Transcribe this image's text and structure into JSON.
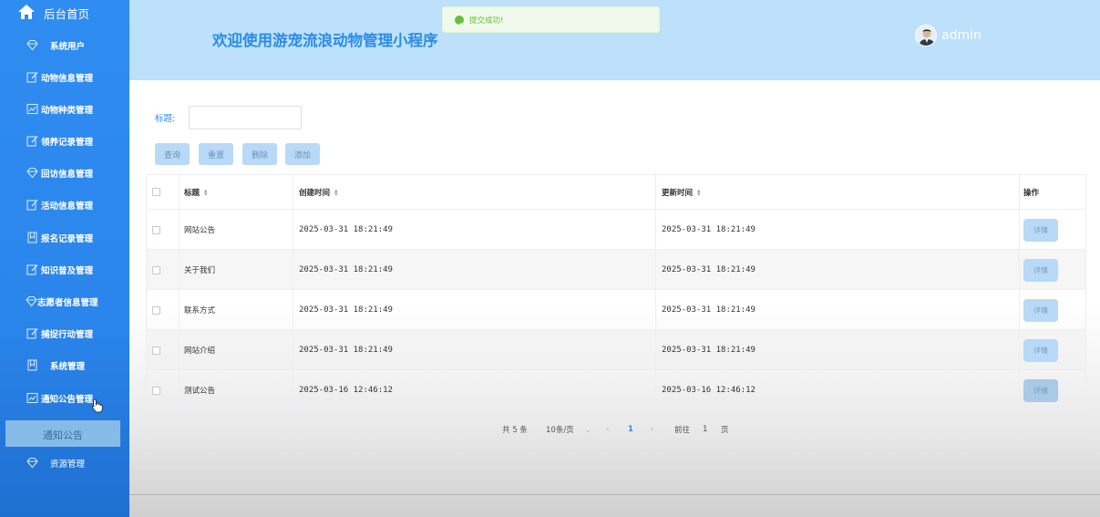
{
  "sidebar": {
    "home_label": "后台首页",
    "items": [
      {
        "label": "系统用户",
        "icon": "gem-icon"
      },
      {
        "label": "动物信息管理",
        "icon": "edit-icon"
      },
      {
        "label": "动物种类管理",
        "icon": "chart-icon"
      },
      {
        "label": "领养记录管理",
        "icon": "edit-icon"
      },
      {
        "label": "回访信息管理",
        "icon": "gem-icon"
      },
      {
        "label": "活动信息管理",
        "icon": "edit-icon"
      },
      {
        "label": "报名记录管理",
        "icon": "bookmark-icon"
      },
      {
        "label": "知识普及管理",
        "icon": "edit-icon"
      },
      {
        "label": "志愿者信息管理",
        "icon": "gem-icon"
      },
      {
        "label": "捕捉行动管理",
        "icon": "edit-icon"
      },
      {
        "label": "系统管理",
        "icon": "bookmark-icon"
      },
      {
        "label": "通知公告管理",
        "icon": "chart-icon"
      }
    ],
    "submenu_label": "通知公告",
    "resource_label": "资源管理"
  },
  "header": {
    "title": "欢迎使用游宠流浪动物管理小程序",
    "username": "admin"
  },
  "toast": {
    "message": "提交成功!",
    "color": "#67c23a"
  },
  "search": {
    "label": "标题:",
    "value": ""
  },
  "actions": {
    "query": "查询",
    "reset": "重置",
    "delete": "删除",
    "add": "添加"
  },
  "table": {
    "headers": {
      "title": "标题",
      "created": "创建时间",
      "updated": "更新时间",
      "operation": "操作"
    },
    "rows": [
      {
        "title": "网站公告",
        "created": "2025-03-31 18:21:49",
        "updated": "2025-03-31 18:21:49",
        "action": "详情"
      },
      {
        "title": "关于我们",
        "created": "2025-03-31 18:21:49",
        "updated": "2025-03-31 18:21:49",
        "action": "详情"
      },
      {
        "title": "联系方式",
        "created": "2025-03-31 18:21:49",
        "updated": "2025-03-31 18:21:49",
        "action": "详情"
      },
      {
        "title": "网站介绍",
        "created": "2025-03-31 18:21:49",
        "updated": "2025-03-31 18:21:49",
        "action": "详情"
      },
      {
        "title": "测试公告",
        "created": "2025-03-16 12:46:12",
        "updated": "2025-03-16 12:46:12",
        "action": "详情"
      }
    ]
  },
  "pagination": {
    "total": "共 5 条",
    "page_size": "10条/页",
    "current_page": "1",
    "goto_label": "前往",
    "goto_value": "1",
    "page_suffix": "页"
  },
  "colors": {
    "sidebar": "#2f8cf0",
    "header": "#bde0fb",
    "accent": "#2b8be8",
    "button": "#b8d9f7"
  }
}
